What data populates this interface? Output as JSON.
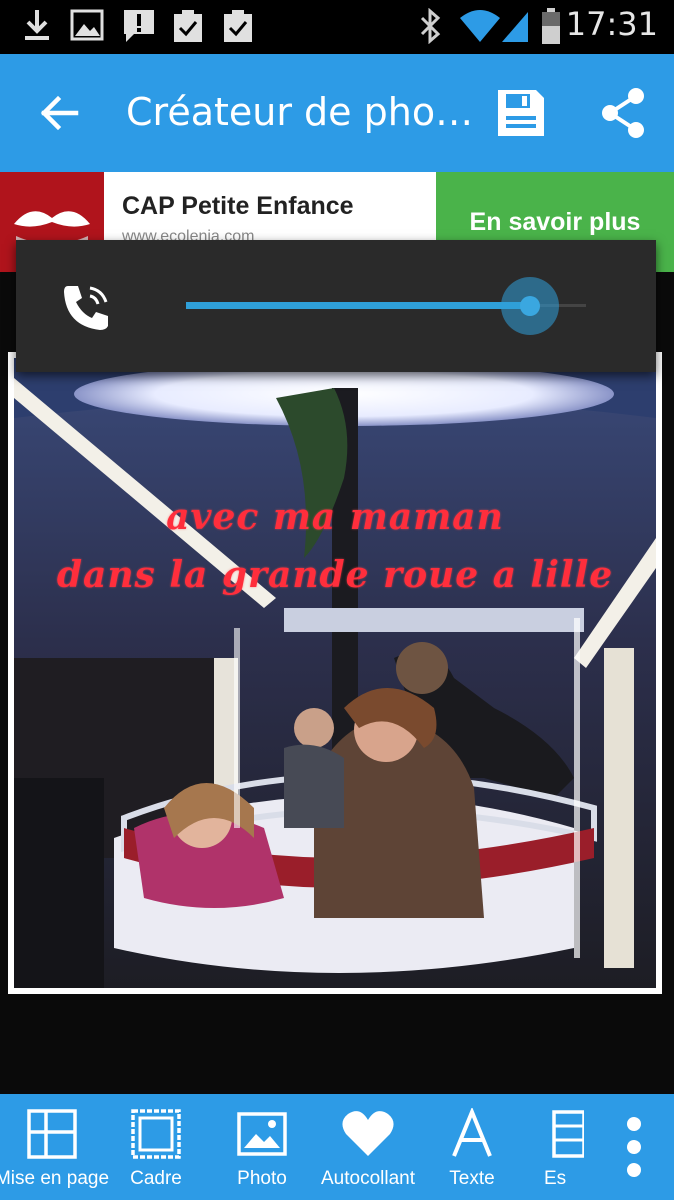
{
  "status_bar": {
    "time": "17:31",
    "icons": [
      "download-icon",
      "image-icon",
      "alert-message-icon",
      "clipboard-check-icon",
      "clipboard-check-icon",
      "bluetooth-icon",
      "wifi-icon",
      "signal-icon",
      "battery-icon"
    ]
  },
  "app_bar": {
    "title": "Créateur de pho…",
    "back_icon": "arrow-back-icon",
    "save_icon": "save-icon",
    "share_icon": "share-icon"
  },
  "ad": {
    "title": "CAP Petite Enfance",
    "url": "www.ecolenia.com",
    "cta": "En savoir plus"
  },
  "volume": {
    "icon": "phone-in-call-icon",
    "level": 0.86
  },
  "photo": {
    "caption_line1": "avec ma maman",
    "caption_line2": "dans la grande roue a lille"
  },
  "toolbar": {
    "items": [
      {
        "label": "Mise en page",
        "icon": "layout-grid-icon"
      },
      {
        "label": "Cadre",
        "icon": "frame-icon"
      },
      {
        "label": "Photo",
        "icon": "image-icon"
      },
      {
        "label": "Autocollant",
        "icon": "heart-icon"
      },
      {
        "label": "Texte",
        "icon": "text-icon"
      },
      {
        "label": "Es",
        "icon": "layers-icon"
      }
    ],
    "overflow_icon": "more-vert-icon"
  },
  "colors": {
    "app_bar": "#2d9be6",
    "ad_cta": "#4ab34a",
    "caption": "#ff2e3c",
    "volume_accent": "#2f9fd8"
  }
}
